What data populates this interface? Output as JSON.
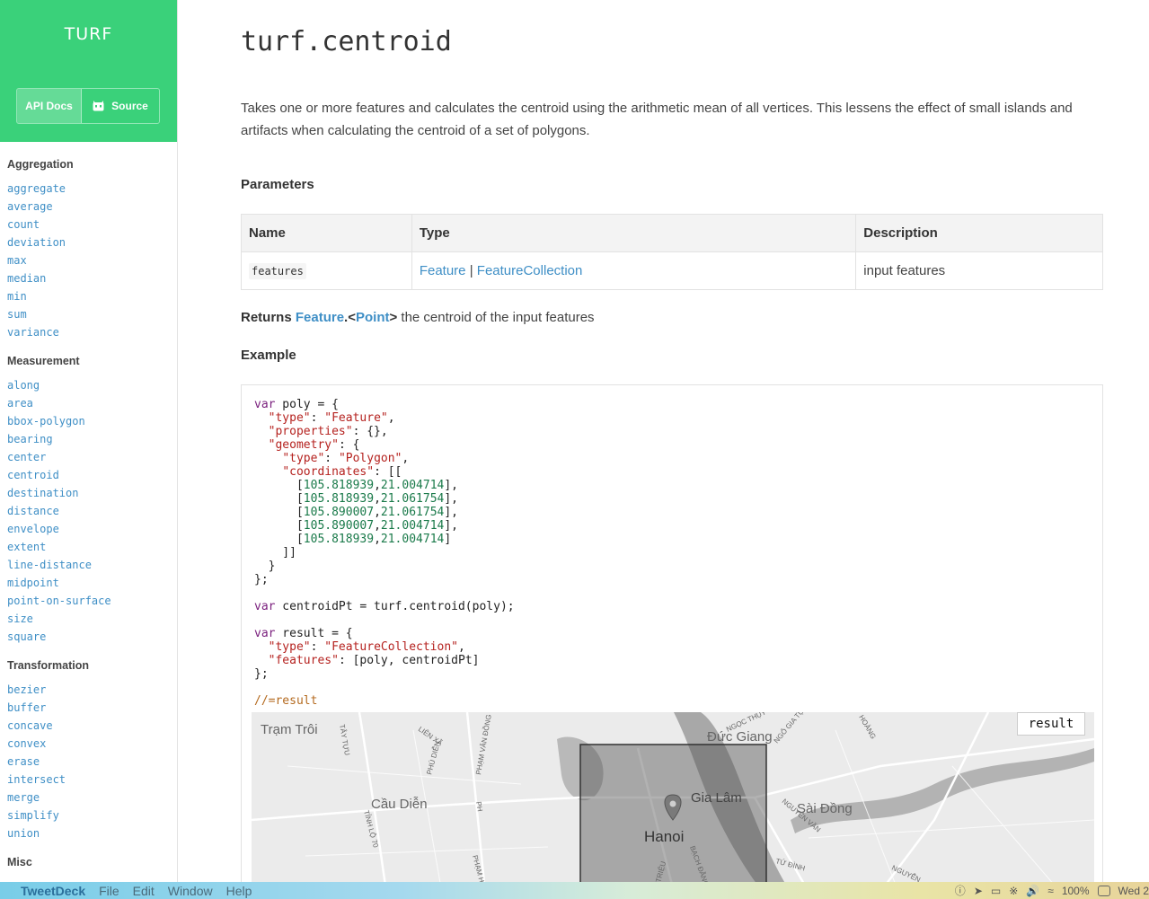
{
  "brand": {
    "title": "TURF",
    "api_docs": "API Docs",
    "source": "Source"
  },
  "nav": [
    {
      "heading": "Aggregation",
      "items": [
        "aggregate",
        "average",
        "count",
        "deviation",
        "max",
        "median",
        "min",
        "sum",
        "variance"
      ]
    },
    {
      "heading": "Measurement",
      "items": [
        "along",
        "area",
        "bbox-polygon",
        "bearing",
        "center",
        "centroid",
        "destination",
        "distance",
        "envelope",
        "extent",
        "line-distance",
        "midpoint",
        "point-on-surface",
        "size",
        "square"
      ]
    },
    {
      "heading": "Transformation",
      "items": [
        "bezier",
        "buffer",
        "concave",
        "convex",
        "erase",
        "intersect",
        "merge",
        "simplify",
        "union"
      ]
    },
    {
      "heading": "Misc",
      "items": []
    }
  ],
  "page": {
    "title": "turf.centroid",
    "description": "Takes one or more features and calculates the centroid using the arithmetic mean of all vertices. This lessens the effect of small islands and artifacts when calculating the centroid of a set of polygons.",
    "parameters_heading": "Parameters",
    "table": {
      "headers": [
        "Name",
        "Type",
        "Description"
      ],
      "row": {
        "name": "features",
        "type1": "Feature",
        "sep": "|",
        "type2": "FeatureCollection",
        "description": "input features"
      }
    },
    "returns": {
      "label": "Returns",
      "type": "Feature",
      "dot": ".<",
      "point": "Point",
      "close": ">",
      "text": " the centroid of the input features"
    },
    "example_heading": "Example",
    "result_button": "result",
    "comment": "//=result"
  },
  "map": {
    "labels": [
      "Trạm Trôi",
      "Đức Giang",
      "Cầu Diễn",
      "Gia Lâm",
      "Sài Đồng",
      "Hanoi",
      "TÂY TỰU",
      "LIÊN XÃ",
      "PHẠM VĂN ĐỒNG",
      "PHÚ DIỄN",
      "TỈNH LỘ 70",
      "NGỌC THỤY",
      "NGÔ GIA TỰ",
      "NGUYỄN VĂN",
      "TỨ ĐÌNH",
      "NGUYỄN",
      "PHẠM HÙNG",
      "BẠCH ĐẰNG",
      "TRIỆU",
      "PH",
      "HOÀNG"
    ]
  },
  "menubar": {
    "app": "TweetDeck",
    "items": [
      "File",
      "Edit",
      "Window",
      "Help"
    ],
    "battery": "100%",
    "clock": "Wed 2"
  }
}
